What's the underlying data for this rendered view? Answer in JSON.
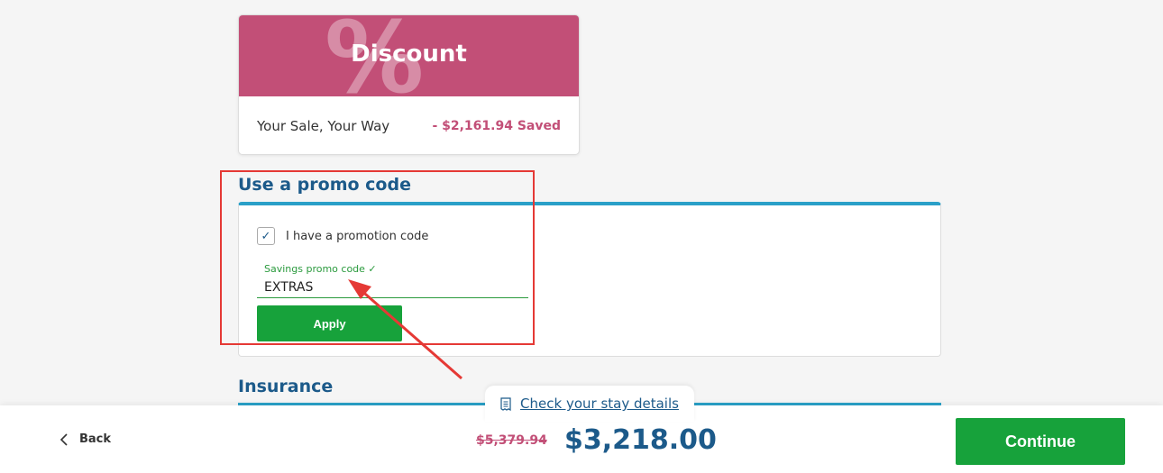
{
  "discount": {
    "symbol": "%",
    "title": "Discount",
    "label": "Your Sale, Your Way",
    "saved": "- $2,161.94 Saved"
  },
  "promo": {
    "heading": "Use a promo code",
    "checkbox_checked": true,
    "checkbox_label": "I have a promotion code",
    "field_label": "Savings promo code ✓",
    "field_value": "EXTRAS",
    "apply_label": "Apply"
  },
  "insurance": {
    "heading": "Insurance"
  },
  "footer": {
    "back_label": "Back",
    "stay_details_label": "Check your stay details",
    "old_price": "$5,379.94",
    "new_price": "$3,218.00",
    "continue_label": "Continue"
  },
  "colors": {
    "accent_pink": "#c24f77",
    "brand_blue": "#1c5a8a",
    "action_green": "#17a23b",
    "annotation_red": "#e53935"
  }
}
